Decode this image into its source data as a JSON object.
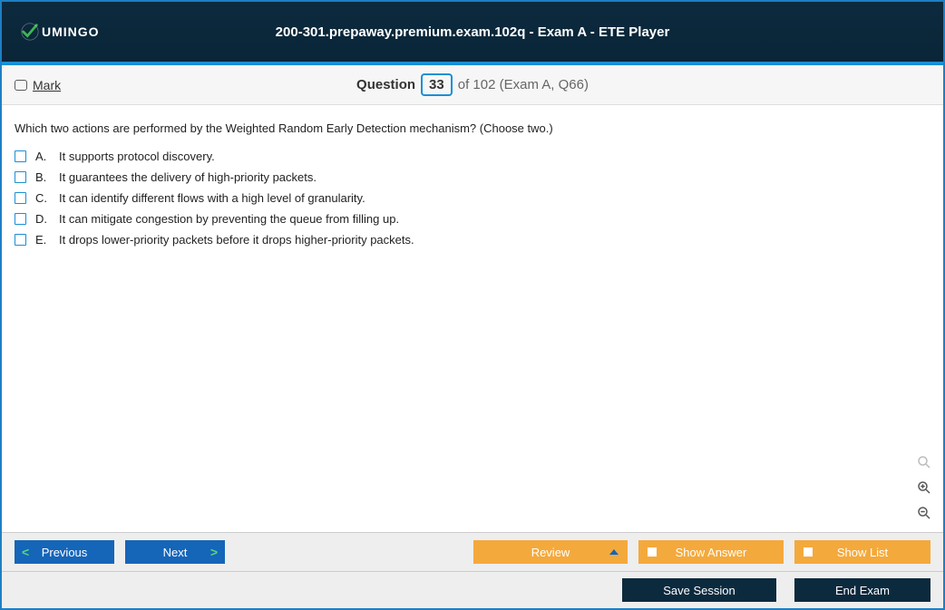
{
  "window": {
    "title": "200-301.prepaway.premium.exam.102q - Exam A - ETE Player",
    "logo_text": "UMINGO"
  },
  "header": {
    "mark_label": "Mark",
    "question_word": "Question",
    "current_number": "33",
    "total_suffix": "of 102 (Exam A, Q66)"
  },
  "question": {
    "text": "Which two actions are performed by the Weighted Random Early Detection mechanism? (Choose two.)",
    "options": [
      {
        "letter": "A.",
        "text": "It supports protocol discovery."
      },
      {
        "letter": "B.",
        "text": "It guarantees the delivery of high-priority packets."
      },
      {
        "letter": "C.",
        "text": "It can identify different flows with a high level of granularity."
      },
      {
        "letter": "D.",
        "text": "It can mitigate congestion by preventing the queue from filling up."
      },
      {
        "letter": "E.",
        "text": "It drops lower-priority packets before it drops higher-priority packets."
      }
    ]
  },
  "buttons": {
    "previous": "Previous",
    "next": "Next",
    "review": "Review",
    "show_answer": "Show Answer",
    "show_list": "Show List",
    "save_session": "Save Session",
    "end_exam": "End Exam"
  }
}
